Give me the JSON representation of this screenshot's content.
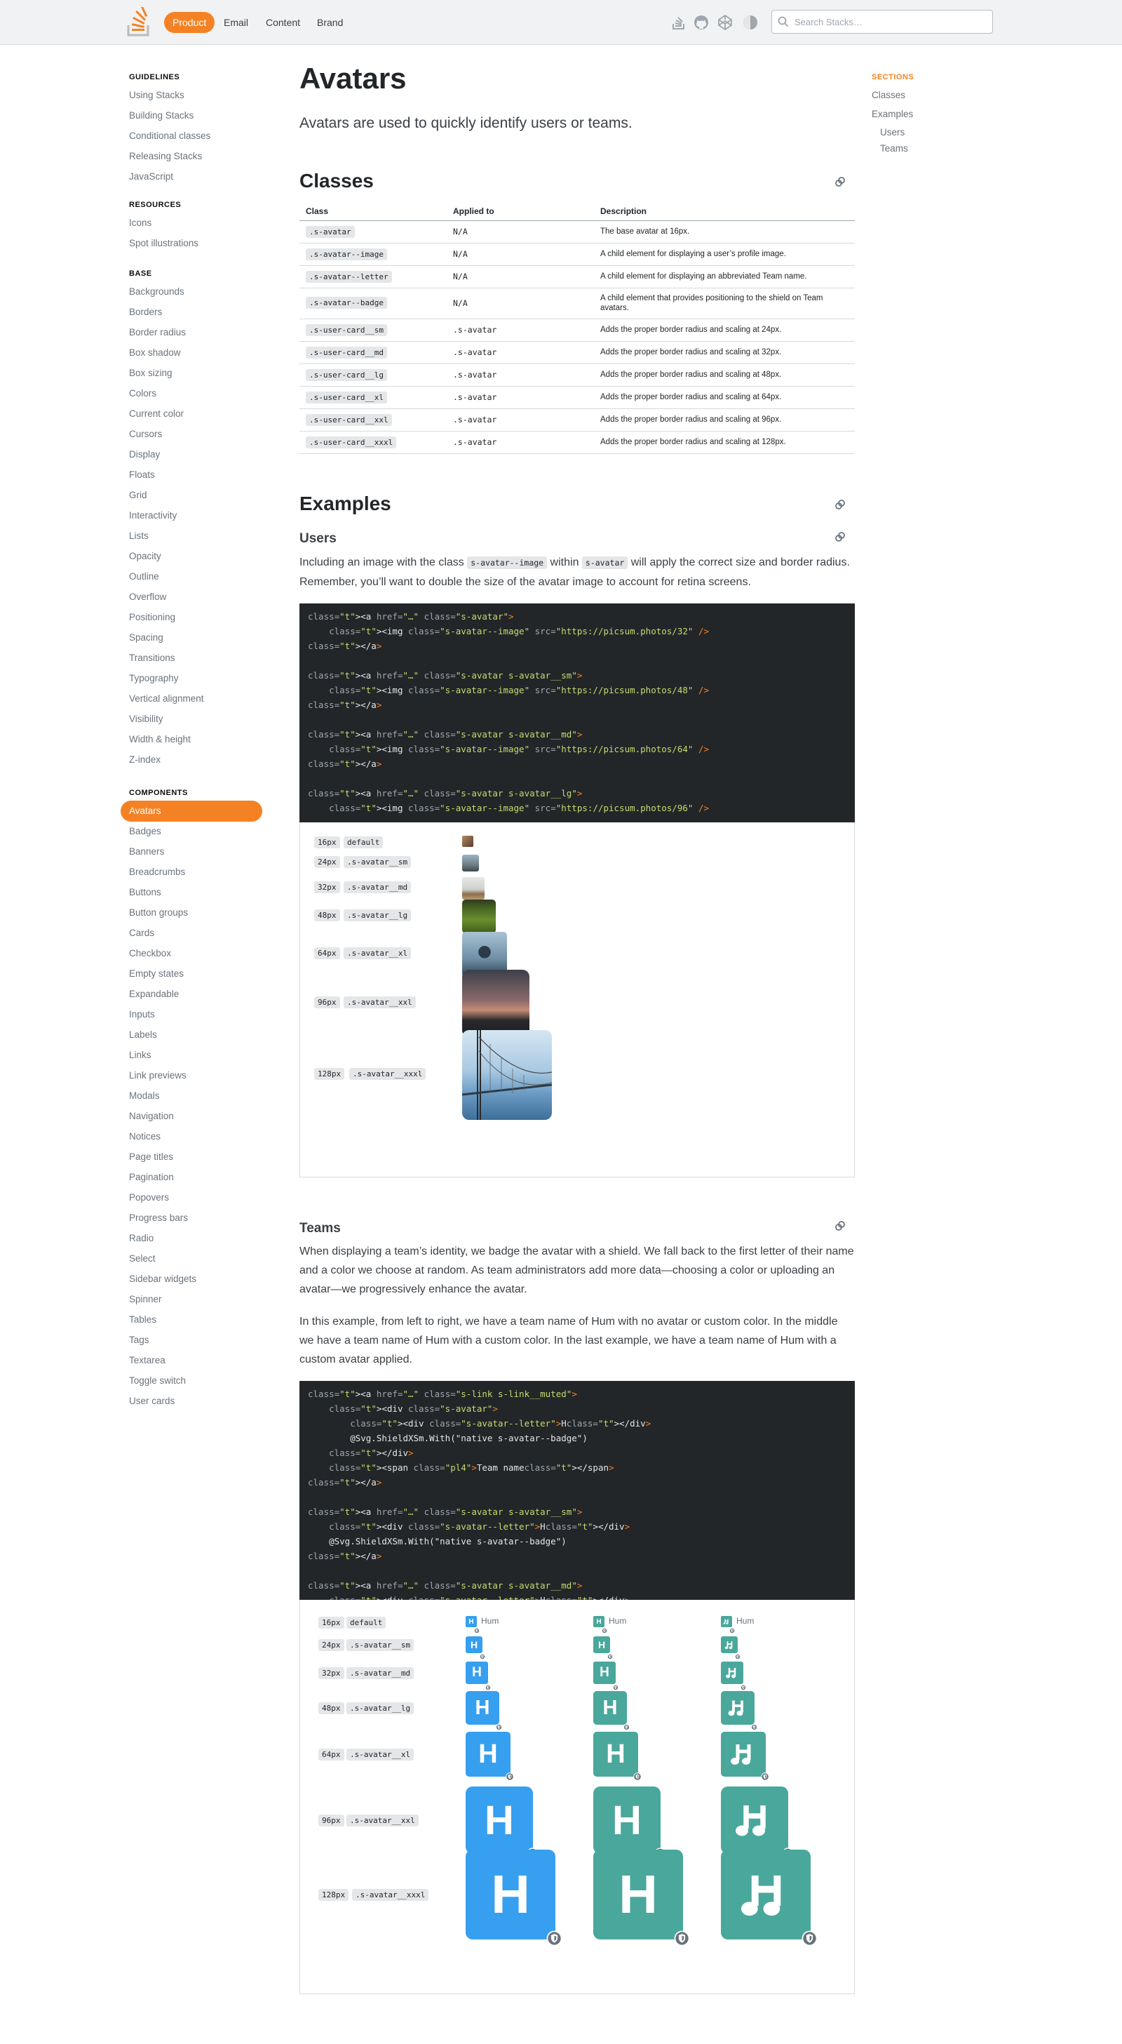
{
  "topbar": {
    "nav": [
      "Product",
      "Email",
      "Content",
      "Brand"
    ],
    "search_placeholder": "Search Stacks…"
  },
  "sidebar": {
    "guidelines": {
      "title": "GUIDELINES",
      "items": [
        "Using Stacks",
        "Building Stacks",
        "Conditional classes",
        "Releasing Stacks",
        "JavaScript"
      ]
    },
    "resources": {
      "title": "RESOURCES",
      "items": [
        "Icons",
        "Spot illustrations"
      ]
    },
    "base": {
      "title": "BASE",
      "items": [
        "Backgrounds",
        "Borders",
        "Border radius",
        "Box shadow",
        "Box sizing",
        "Colors",
        "Current color",
        "Cursors",
        "Display",
        "Floats",
        "Grid",
        "Interactivity",
        "Lists",
        "Opacity",
        "Outline",
        "Overflow",
        "Positioning",
        "Spacing",
        "Transitions",
        "Typography",
        "Vertical alignment",
        "Visibility",
        "Width & height",
        "Z-index"
      ]
    },
    "components": {
      "title": "COMPONENTS",
      "items": [
        "Avatars",
        "Badges",
        "Banners",
        "Breadcrumbs",
        "Buttons",
        "Button groups",
        "Cards",
        "Checkbox",
        "Empty states",
        "Expandable",
        "Inputs",
        "Labels",
        "Links",
        "Link previews",
        "Modals",
        "Navigation",
        "Notices",
        "Page titles",
        "Pagination",
        "Popovers",
        "Progress bars",
        "Radio",
        "Select",
        "Sidebar widgets",
        "Spinner",
        "Tables",
        "Tags",
        "Textarea",
        "Toggle switch",
        "User cards"
      ]
    }
  },
  "sections": {
    "title": "SECTIONS",
    "items": [
      "Classes",
      "Examples",
      "Users",
      "Teams"
    ]
  },
  "page": {
    "title": "Avatars",
    "lead": "Avatars are used to quickly identify users or teams."
  },
  "classes": {
    "heading": "Classes",
    "headers": [
      "Class",
      "Applied to",
      "Description"
    ],
    "rows": [
      [
        ".s-avatar",
        "N/A",
        "The base avatar at 16px."
      ],
      [
        ".s-avatar--image",
        "N/A",
        "A child element for displaying a user’s profile image."
      ],
      [
        ".s-avatar--letter",
        "N/A",
        "A child element for displaying an abbreviated Team name."
      ],
      [
        ".s-avatar--badge",
        "N/A",
        "A child element that provides positioning to the shield on Team avatars."
      ],
      [
        ".s-user-card__sm",
        ".s-avatar",
        "Adds the proper border radius and scaling at 24px."
      ],
      [
        ".s-user-card__md",
        ".s-avatar",
        "Adds the proper border radius and scaling at 32px."
      ],
      [
        ".s-user-card__lg",
        ".s-avatar",
        "Adds the proper border radius and scaling at 48px."
      ],
      [
        ".s-user-card__xl",
        ".s-avatar",
        "Adds the proper border radius and scaling at 64px."
      ],
      [
        ".s-user-card__xxl",
        ".s-avatar",
        "Adds the proper border radius and scaling at 96px."
      ],
      [
        ".s-user-card__xxxl",
        ".s-avatar",
        "Adds the proper border radius and scaling at 128px."
      ]
    ]
  },
  "examples": {
    "heading": "Examples",
    "users": {
      "heading": "Users",
      "p_before1": "Including an image with the class ",
      "code1": "s-avatar--image",
      "p_mid": " within ",
      "code2": "s-avatar",
      "p_after": " will apply the correct size and border radius. Remember, you’ll want to double the size of the avatar image to account for retina screens.",
      "sizes": [
        {
          "px": "16px",
          "cls": "default"
        },
        {
          "px": "24px",
          "cls": ".s-avatar__sm"
        },
        {
          "px": "32px",
          "cls": ".s-avatar__md"
        },
        {
          "px": "48px",
          "cls": ".s-avatar__lg"
        },
        {
          "px": "64px",
          "cls": ".s-avatar__xl"
        },
        {
          "px": "96px",
          "cls": ".s-avatar__xxl"
        },
        {
          "px": "128px",
          "cls": ".s-avatar__xxxl"
        }
      ]
    },
    "teams": {
      "heading": "Teams",
      "p1": "When displaying a team’s identity, we badge the avatar with a shield. We fall back to the first letter of their name and a color we choose at random. As team administrators add more data—choosing a color or uploading an avatar—we progressively enhance the avatar.",
      "p2": "In this example, from left to right, we have a team name of Hum with no avatar or custom color. In the middle we have a team name of Hum with a custom color. In the last example, we have a team name of Hum with a custom avatar applied.",
      "letter": "H",
      "name": "Hum",
      "sizes": [
        {
          "px": "16px",
          "cls": "default"
        },
        {
          "px": "24px",
          "cls": ".s-avatar__sm"
        },
        {
          "px": "32px",
          "cls": ".s-avatar__md"
        },
        {
          "px": "48px",
          "cls": ".s-avatar__lg"
        },
        {
          "px": "64px",
          "cls": ".s-avatar__xl"
        },
        {
          "px": "96px",
          "cls": ".s-avatar__xxl"
        },
        {
          "px": "128px",
          "cls": ".s-avatar__xxxl"
        }
      ]
    }
  },
  "code_users": [
    "<a href=\"…\" class=\"s-avatar\">",
    "    <img class=\"s-avatar--image\" src=\"https://picsum.photos/32\" />",
    "</a>",
    "",
    "<a href=\"…\" class=\"s-avatar s-avatar__sm\">",
    "    <img class=\"s-avatar--image\" src=\"https://picsum.photos/48\" />",
    "</a>",
    "",
    "<a href=\"…\" class=\"s-avatar s-avatar__md\">",
    "    <img class=\"s-avatar--image\" src=\"https://picsum.photos/64\" />",
    "</a>",
    "",
    "<a href=\"…\" class=\"s-avatar s-avatar__lg\">",
    "    <img class=\"s-avatar--image\" src=\"https://picsum.photos/96\" />"
  ],
  "code_teams": [
    "<a href=\"…\" class=\"s-link s-link__muted\">",
    "    <div class=\"s-avatar\">",
    "        <div class=\"s-avatar--letter\">H</div>",
    "        @Svg.ShieldXSm.With(\"native s-avatar--badge\")",
    "    </div>",
    "    <span class=\"pl4\">Team name</span>",
    "</a>",
    "",
    "<a href=\"…\" class=\"s-avatar s-avatar__sm\">",
    "    <div class=\"s-avatar--letter\">H</div>",
    "    @Svg.ShieldXSm.With(\"native s-avatar--badge\")",
    "</a>",
    "",
    "<a href=\"…\" class=\"s-avatar s-avatar__md\">",
    "    <div class=\"s-avatar--letter\">H</div>"
  ],
  "colors": {
    "accent": "#f48225",
    "team_blue": "#379fef",
    "team_green": "#4aa79b",
    "code_bg": "#232629"
  }
}
